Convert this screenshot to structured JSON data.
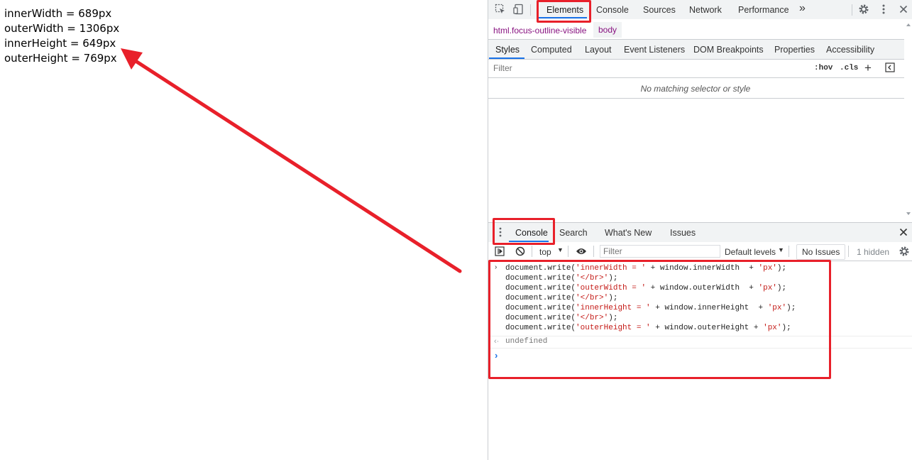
{
  "page": {
    "lines": [
      "innerWidth = 689px",
      "outerWidth = 1306px",
      "innerHeight = 649px",
      "outerHeight = 769px"
    ]
  },
  "devtools": {
    "tabs": [
      "Elements",
      "Console",
      "Sources",
      "Network",
      "Performance"
    ],
    "more_tabs": "»",
    "breadcrumb": [
      "html.focus-outline-visible",
      "body"
    ],
    "subtabs": [
      "Styles",
      "Computed",
      "Layout",
      "Event Listeners",
      "DOM Breakpoints",
      "Properties",
      "Accessibility"
    ],
    "styles": {
      "filter_placeholder": "Filter",
      "hov": ":hov",
      "cls": ".cls",
      "empty_message": "No matching selector or style"
    },
    "drawer": {
      "tabs": [
        "Console",
        "Search",
        "What's New",
        "Issues"
      ],
      "context": "top",
      "filter_placeholder": "Filter",
      "levels": "Default levels",
      "no_issues": "No Issues",
      "hidden": "1 hidden"
    },
    "console": {
      "code": [
        [
          "document.write(",
          "'innerWidth = '",
          " + window.innerWidth  + ",
          "'px'",
          ");"
        ],
        [
          "document.write(",
          "'</br>'",
          ");",
          "",
          ""
        ],
        [
          "document.write(",
          "'outerWidth = '",
          " + window.outerWidth  + ",
          "'px'",
          ");"
        ],
        [
          "document.write(",
          "'</br>'",
          ");",
          "",
          ""
        ],
        [
          "document.write(",
          "'innerHeight = '",
          " + window.innerHeight  + ",
          "'px'",
          ");"
        ],
        [
          "document.write(",
          "'</br>'",
          ");",
          "",
          ""
        ],
        [
          "document.write(",
          "'outerHeight = '",
          " + window.outerHeight + ",
          "'px'",
          ");"
        ]
      ],
      "result": "undefined"
    }
  }
}
